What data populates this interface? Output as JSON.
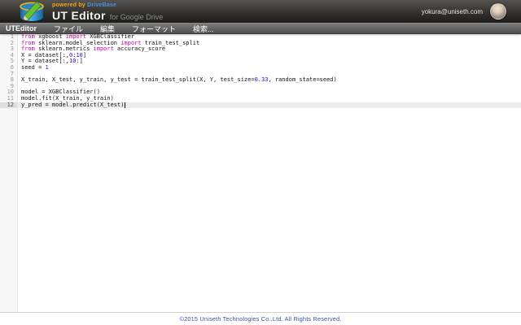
{
  "header": {
    "powered_by": "powered by",
    "brand": "DriveBase",
    "app_title": "UT Editor",
    "app_subtitle": "for Google Drive",
    "user_email": "yokura@uniseth.com"
  },
  "menu": {
    "items": [
      {
        "id": "uteditor",
        "label": "UTEditor",
        "bold": true
      },
      {
        "id": "file",
        "label": "ファイル"
      },
      {
        "id": "edit",
        "label": "編集"
      },
      {
        "id": "format",
        "label": "フォーマット"
      },
      {
        "id": "search",
        "label": "検索..."
      }
    ]
  },
  "editor": {
    "language": "python",
    "active_line": 12,
    "cursor_after_text": "y_pred = model.predict(X_test)",
    "lines": [
      {
        "n": 1,
        "tokens": [
          {
            "t": "kw",
            "v": "from"
          },
          {
            "t": "p",
            "v": " xgboost "
          },
          {
            "t": "kw",
            "v": "import"
          },
          {
            "t": "p",
            "v": " XGBClassifier"
          }
        ]
      },
      {
        "n": 2,
        "tokens": [
          {
            "t": "kw",
            "v": "from"
          },
          {
            "t": "p",
            "v": " sklearn.model_selection "
          },
          {
            "t": "kw",
            "v": "import"
          },
          {
            "t": "p",
            "v": " train_test_split"
          }
        ]
      },
      {
        "n": 3,
        "tokens": [
          {
            "t": "kw",
            "v": "from"
          },
          {
            "t": "p",
            "v": " sklearn.metrics "
          },
          {
            "t": "kw",
            "v": "import"
          },
          {
            "t": "p",
            "v": " accuracy_score"
          }
        ]
      },
      {
        "n": 4,
        "tokens": [
          {
            "t": "p",
            "v": "X = dataset[:,"
          },
          {
            "t": "num",
            "v": "0"
          },
          {
            "t": "p",
            "v": ":"
          },
          {
            "t": "num",
            "v": "10"
          },
          {
            "t": "p",
            "v": "]"
          }
        ]
      },
      {
        "n": 5,
        "tokens": [
          {
            "t": "p",
            "v": "Y = dataset[:,"
          },
          {
            "t": "num",
            "v": "10"
          },
          {
            "t": "p",
            "v": ":]"
          }
        ]
      },
      {
        "n": 6,
        "tokens": [
          {
            "t": "p",
            "v": "seed = "
          },
          {
            "t": "num",
            "v": "1"
          }
        ]
      },
      {
        "n": 7,
        "tokens": []
      },
      {
        "n": 8,
        "tokens": [
          {
            "t": "p",
            "v": "X_train, X_test, y_train, y_test = train_test_split(X, Y, test_size="
          },
          {
            "t": "num",
            "v": "0.33"
          },
          {
            "t": "p",
            "v": ", random_state=seed)"
          }
        ]
      },
      {
        "n": 9,
        "tokens": []
      },
      {
        "n": 10,
        "tokens": [
          {
            "t": "p",
            "v": "model = XGBClassifier()"
          }
        ]
      },
      {
        "n": 11,
        "tokens": [
          {
            "t": "p",
            "v": "model.fit(X_train, y_train)"
          }
        ]
      },
      {
        "n": 12,
        "tokens": [
          {
            "t": "p",
            "v": "y_pred = model.predict(X_test)"
          }
        ]
      }
    ]
  },
  "footer": {
    "copyright": "©2015 Uniseth Technologies Co.,Ltd. All Rights Reserved."
  },
  "colors": {
    "keyword": "#C800A4",
    "number": "#3A00DC",
    "plain_code": "#111111",
    "brand_blue": "#4a90d9",
    "powered_orange": "#f5a31d",
    "footer_blue": "#3a57a7",
    "active_line_bg": "#ececec"
  }
}
